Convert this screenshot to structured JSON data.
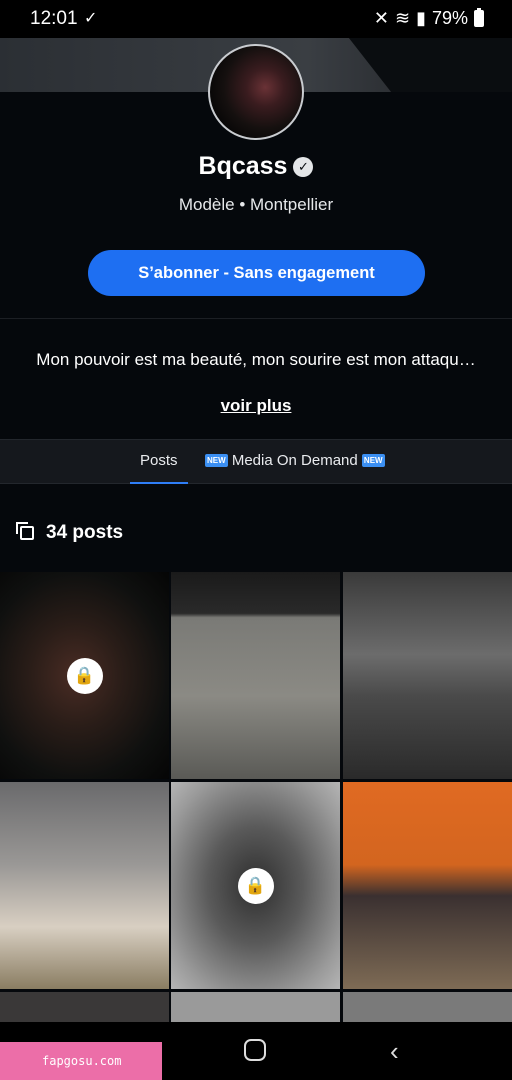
{
  "status_bar": {
    "time": "12:01",
    "battery": "79%"
  },
  "profile": {
    "name": "Bqcass",
    "subtitle": "Modèle • Montpellier",
    "subscribe_label": "S’abonner - Sans engagement",
    "bio": "Mon pouvoir est ma beauté, mon sourire est mon attaqu…",
    "see_more": "voir plus"
  },
  "tabs": [
    {
      "label": "Posts",
      "active": true
    },
    {
      "label": "Media On Demand",
      "badge": "NEW"
    }
  ],
  "posts_count": "34 posts",
  "grid": [
    {
      "locked": true
    },
    {
      "locked": false
    },
    {
      "locked": false
    },
    {
      "locked": false
    },
    {
      "locked": true
    },
    {
      "locked": false
    }
  ],
  "accent_color": "#1e6ff2",
  "watermark": "fapgosu.com"
}
